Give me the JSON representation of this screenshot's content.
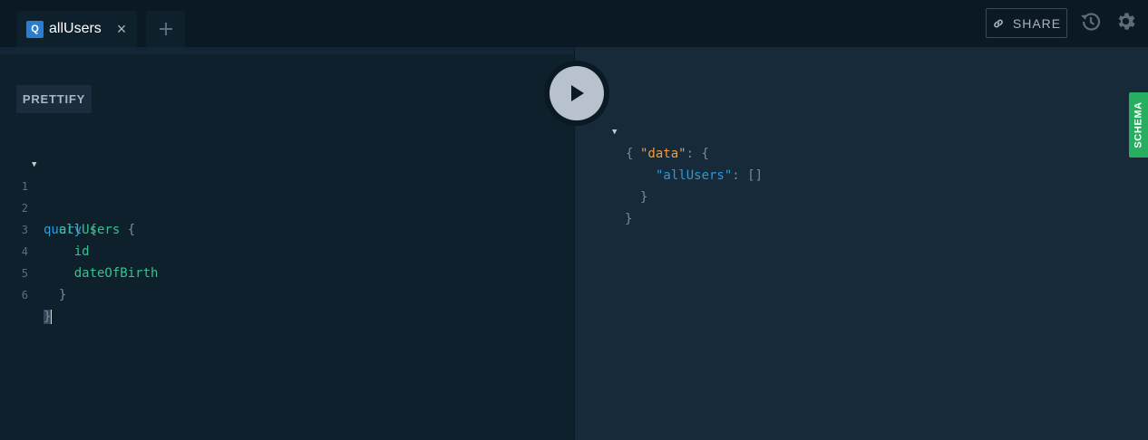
{
  "tabs": [
    {
      "badge": "Q",
      "title": "allUsers",
      "close": "×"
    }
  ],
  "toolbar": {
    "share_label": "SHARE",
    "prettify_label": "PRETTIFY"
  },
  "editor": {
    "line_numbers": [
      "1",
      "2",
      "3",
      "4",
      "5",
      "6"
    ],
    "lines": [
      {
        "keyword": "query",
        "brace": "{"
      },
      {
        "field": "allUsers",
        "brace": "{"
      },
      {
        "field": "id"
      },
      {
        "field": "dateOfBirth"
      },
      {
        "brace": "}"
      },
      {
        "brace": "}"
      }
    ]
  },
  "result": {
    "open_brace": "{",
    "data_key": "\"data\"",
    "colon": ":",
    "data_brace": "{",
    "users_key": "\"allUsers\"",
    "users_value": "[]",
    "inner_close": "}",
    "outer_close": "}"
  },
  "sidebar": {
    "schema_label": "SCHEMA"
  },
  "icons": {
    "share": "link-icon",
    "history": "history-icon",
    "settings": "gear-icon",
    "execute": "play-icon",
    "add_tab": "plus-icon"
  },
  "colors": {
    "keyword": "#2a9ad8",
    "field": "#37c08d",
    "string_key": "#f29b3c",
    "schema_tab": "#27ae60",
    "badge": "#2a7ed2"
  }
}
